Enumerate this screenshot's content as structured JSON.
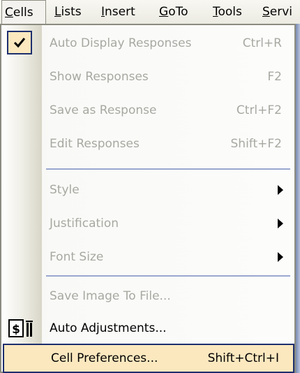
{
  "menubar": {
    "items": [
      {
        "label": "Cells",
        "mnemonic": "C"
      },
      {
        "label": "Lists",
        "mnemonic": "L"
      },
      {
        "label": "Insert",
        "mnemonic": "I"
      },
      {
        "label": "GoTo",
        "mnemonic": "G"
      },
      {
        "label": "Tools",
        "mnemonic": "T"
      },
      {
        "label": "Servi",
        "mnemonic": "S"
      }
    ]
  },
  "menu": {
    "items": [
      {
        "label": "Auto Display Responses",
        "shortcut": "Ctrl+R",
        "enabled": false,
        "checked": true
      },
      {
        "label": "Show Responses",
        "shortcut": "F2",
        "enabled": false
      },
      {
        "label": "Save as Response",
        "shortcut": "Ctrl+F2",
        "enabled": false
      },
      {
        "label": "Edit Responses",
        "shortcut": "Shift+F2",
        "enabled": false
      },
      {
        "label": "Style",
        "enabled": false,
        "submenu": true
      },
      {
        "label": "Justification",
        "enabled": false,
        "submenu": true
      },
      {
        "label": "Font Size",
        "enabled": false,
        "submenu": true
      },
      {
        "label": "Save Image To File...",
        "enabled": false
      },
      {
        "label": "Auto Adjustments...",
        "enabled": true,
        "icon": "auto-adjustments-icon"
      },
      {
        "label": "Cell Preferences...",
        "shortcut": "Shift+Ctrl+I",
        "enabled": true,
        "highlighted": true
      }
    ]
  },
  "colors": {
    "highlight_fill": "#fbe8bf",
    "highlight_border": "#1d2f6e",
    "disabled_text": "#a8a8a2",
    "separator": "#9aa7cf"
  }
}
